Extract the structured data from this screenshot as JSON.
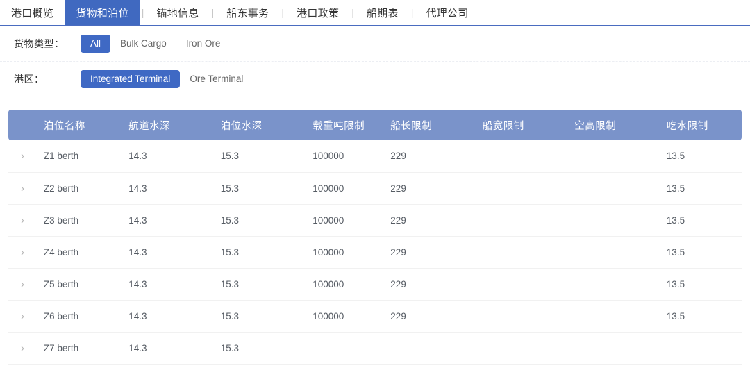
{
  "tabs": [
    {
      "label": "港口概览",
      "active": false
    },
    {
      "label": "货物和泊位",
      "active": true
    },
    {
      "label": "锚地信息",
      "active": false
    },
    {
      "label": "船东事务",
      "active": false
    },
    {
      "label": "港口政策",
      "active": false
    },
    {
      "label": "船期表",
      "active": false
    },
    {
      "label": "代理公司",
      "active": false
    }
  ],
  "tab_separator": "|",
  "filters": [
    {
      "label": "货物类型：",
      "options": [
        {
          "label": "All",
          "selected": true
        },
        {
          "label": "Bulk Cargo",
          "selected": false
        },
        {
          "label": "Iron Ore",
          "selected": false
        }
      ]
    },
    {
      "label": "港区：",
      "options": [
        {
          "label": "Integrated Terminal",
          "selected": true
        },
        {
          "label": "Ore Terminal",
          "selected": false
        }
      ]
    }
  ],
  "table": {
    "expand_icon": "›",
    "columns": [
      "",
      "泊位名称",
      "航道水深",
      "泊位水深",
      "载重吨限制",
      "船长限制",
      "船宽限制",
      "空高限制",
      "吃水限制"
    ],
    "rows": [
      {
        "name": "Z1 berth",
        "channel_depth": "14.3",
        "berth_depth": "15.3",
        "dwt_limit": "100000",
        "loa_limit": "229",
        "beam_limit": "",
        "air_draft_limit": "",
        "draft_limit": "13.5"
      },
      {
        "name": "Z2 berth",
        "channel_depth": "14.3",
        "berth_depth": "15.3",
        "dwt_limit": "100000",
        "loa_limit": "229",
        "beam_limit": "",
        "air_draft_limit": "",
        "draft_limit": "13.5"
      },
      {
        "name": "Z3 berth",
        "channel_depth": "14.3",
        "berth_depth": "15.3",
        "dwt_limit": "100000",
        "loa_limit": "229",
        "beam_limit": "",
        "air_draft_limit": "",
        "draft_limit": "13.5"
      },
      {
        "name": "Z4 berth",
        "channel_depth": "14.3",
        "berth_depth": "15.3",
        "dwt_limit": "100000",
        "loa_limit": "229",
        "beam_limit": "",
        "air_draft_limit": "",
        "draft_limit": "13.5"
      },
      {
        "name": "Z5 berth",
        "channel_depth": "14.3",
        "berth_depth": "15.3",
        "dwt_limit": "100000",
        "loa_limit": "229",
        "beam_limit": "",
        "air_draft_limit": "",
        "draft_limit": "13.5"
      },
      {
        "name": "Z6 berth",
        "channel_depth": "14.3",
        "berth_depth": "15.3",
        "dwt_limit": "100000",
        "loa_limit": "229",
        "beam_limit": "",
        "air_draft_limit": "",
        "draft_limit": "13.5"
      },
      {
        "name": "Z7 berth",
        "channel_depth": "14.3",
        "berth_depth": "15.3",
        "dwt_limit": "",
        "loa_limit": "",
        "beam_limit": "",
        "air_draft_limit": "",
        "draft_limit": ""
      }
    ]
  },
  "colors": {
    "accent_blue": "#4069c0",
    "header_blue": "#7a93ca",
    "chip_blue": "#3f69c4",
    "tab_underline": "#4a6cc0",
    "text_default": "#333333",
    "text_muted": "#666666",
    "cell_text": "#555b63"
  }
}
